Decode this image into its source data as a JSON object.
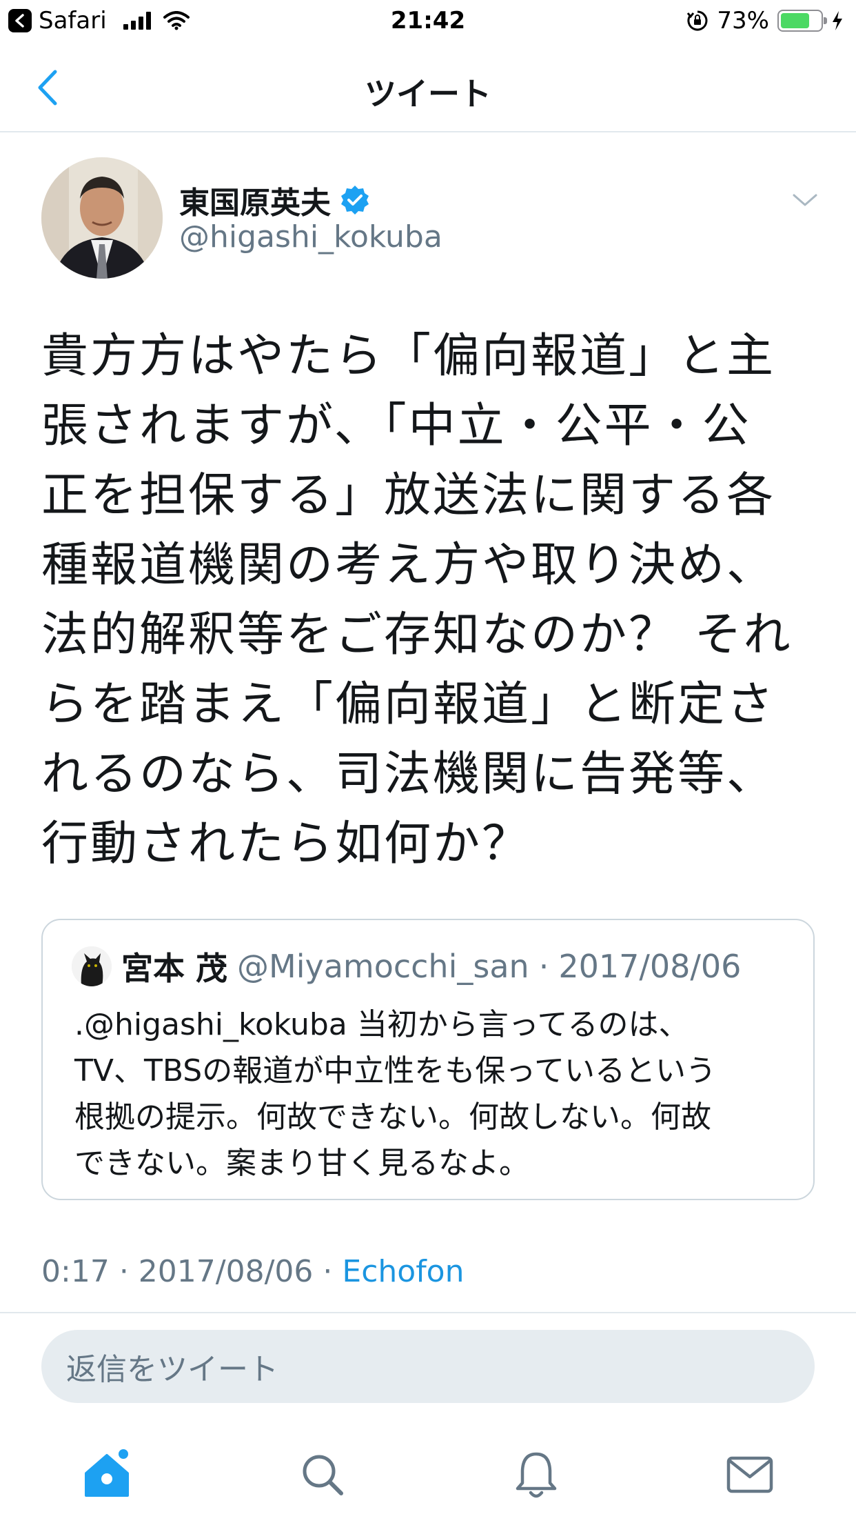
{
  "status_bar": {
    "back_app": "Safari",
    "time": "21:42",
    "battery": "73%",
    "battery_level": 0.73
  },
  "nav": {
    "title": "ツイート"
  },
  "tweet": {
    "author_name": "東国原英夫",
    "author_handle": "@higashi_kokuba",
    "verified": true,
    "lines": [
      "貴方方はやたら「偏向報道」と主",
      "張されますが、「中立・公平・公",
      "正を担保する」放送法に関する各",
      "種報道機関の考え方や取り決め、",
      "法的解釈等をご存知なのか？ それ",
      "らを踏まえ「偏向報道」と断定さ",
      "れるのなら、司法機関に告発等、",
      "行動されたら如何か？"
    ],
    "time": "0:17",
    "date": "2017/08/06",
    "source": "Echofon"
  },
  "quoted": {
    "name": "宮本 茂",
    "handle": "@Miyamocchi_san",
    "date": "2017/08/06",
    "lines": [
      ".@higashi_kokuba 当初から言ってるのは、",
      "TV、TBSの報道が中立性をも保っているという",
      "根拠の提示。何故できない。何故しない。何故",
      "できない。案まり甘く見るなよ。"
    ]
  },
  "reply": {
    "placeholder": "返信をツイート"
  },
  "tabs": [
    "home-icon",
    "search-icon",
    "notifications-icon",
    "messages-icon"
  ],
  "colors": {
    "accent": "#1da1f2",
    "link": "#1b95e0",
    "secondary_text": "#657786",
    "battery": "#4cd964"
  }
}
